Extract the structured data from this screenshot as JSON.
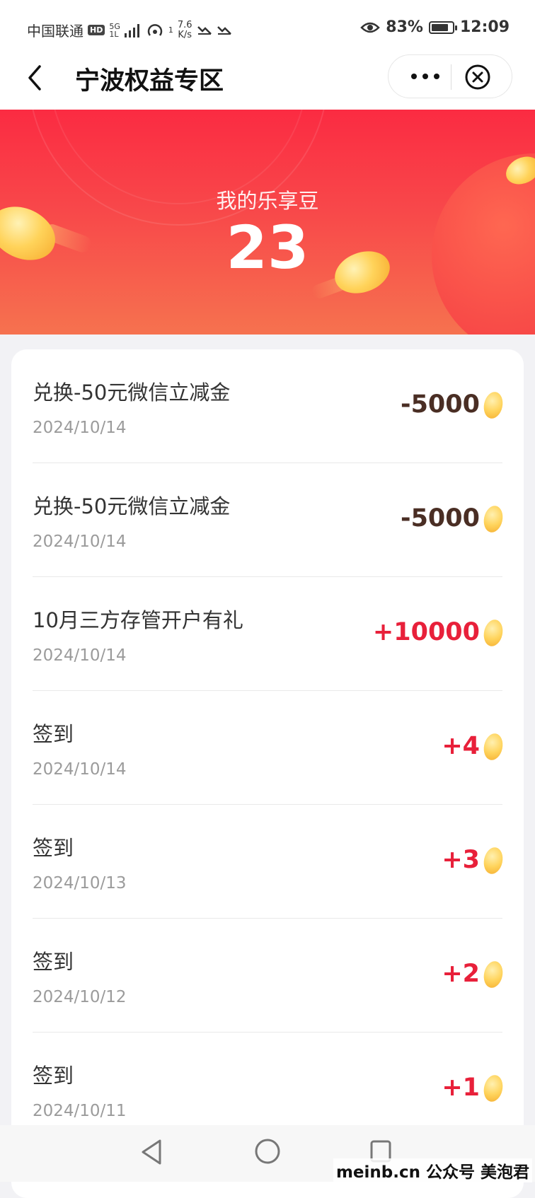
{
  "status_bar": {
    "carrier": "中国联通",
    "hd_badge": "HD",
    "net_type": "5G",
    "net_sub": "1L",
    "wifi_num": "1",
    "speed_value": "7.6",
    "speed_unit": "K/s",
    "battery_pct": "83%",
    "battery_level": 0.83,
    "time": "12:09"
  },
  "nav": {
    "title": "宁波权益专区"
  },
  "banner": {
    "label": "我的乐享豆",
    "value": "23"
  },
  "transactions": [
    {
      "title": "兑换-50元微信立减金",
      "date": "2024/10/14",
      "amount": "-5000",
      "sign": "neg"
    },
    {
      "title": "兑换-50元微信立减金",
      "date": "2024/10/14",
      "amount": "-5000",
      "sign": "neg"
    },
    {
      "title": "10月三方存管开户有礼",
      "date": "2024/10/14",
      "amount": "+10000",
      "sign": "pos"
    },
    {
      "title": "签到",
      "date": "2024/10/14",
      "amount": "+4",
      "sign": "pos"
    },
    {
      "title": "签到",
      "date": "2024/10/13",
      "amount": "+3",
      "sign": "pos"
    },
    {
      "title": "签到",
      "date": "2024/10/12",
      "amount": "+2",
      "sign": "pos"
    },
    {
      "title": "签到",
      "date": "2024/10/11",
      "amount": "+1",
      "sign": "pos"
    }
  ],
  "watermark": "meinb.cn  公众号 美泡君",
  "colors": {
    "accent_red": "#e8203a",
    "negative_brown": "#4a2e24",
    "banner_red": "#fb2b42"
  },
  "icons": {
    "back": "chevron-left-icon",
    "more": "more-dots-icon",
    "close": "close-circle-icon",
    "bean": "bean-icon"
  }
}
